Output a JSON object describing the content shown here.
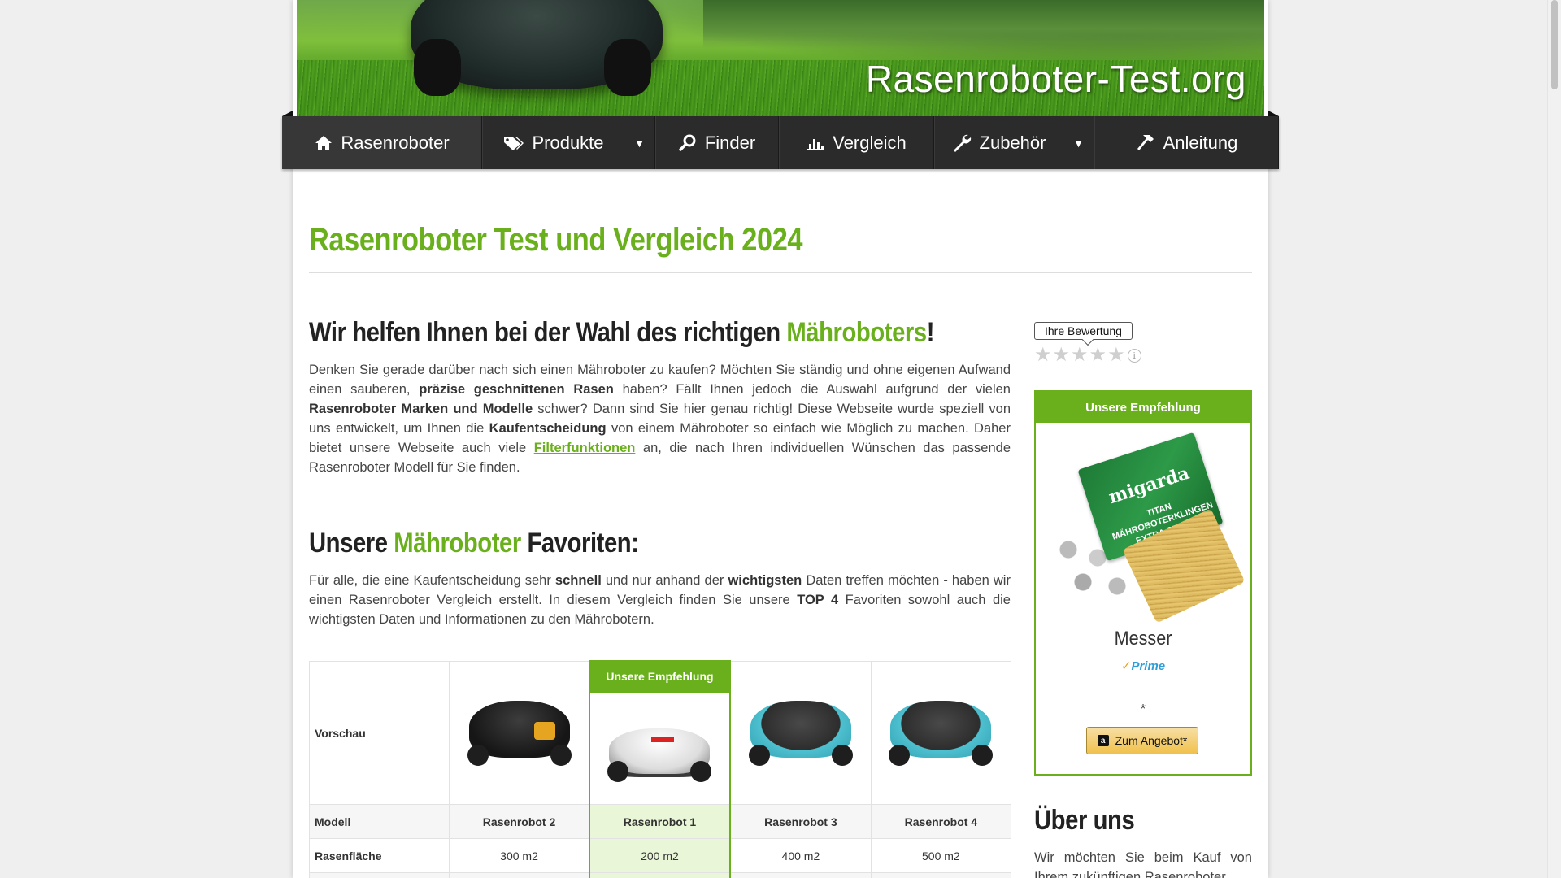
{
  "site": {
    "logo_text": "Rasenroboter-Test.org"
  },
  "nav": {
    "items": [
      {
        "label": "Rasenroboter",
        "icon": "home-icon",
        "has_dropdown": false,
        "active": true
      },
      {
        "label": "Produkte",
        "icon": "tags-icon",
        "has_dropdown": true,
        "active": false
      },
      {
        "label": "Finder",
        "icon": "search-icon",
        "has_dropdown": false,
        "active": false
      },
      {
        "label": "Vergleich",
        "icon": "bar-chart-icon",
        "has_dropdown": false,
        "active": false
      },
      {
        "label": "Zubehör",
        "icon": "wrench-icon",
        "has_dropdown": true,
        "active": false
      },
      {
        "label": "Anleitung",
        "icon": "hammer-icon",
        "has_dropdown": false,
        "active": false
      }
    ],
    "caret": "▼"
  },
  "page": {
    "title": "Rasenroboter Test und Vergleich 2024"
  },
  "intro": {
    "heading_pre": "Wir helfen Ihnen bei der Wahl des richtigen ",
    "heading_hl": "Mähroboters",
    "heading_post": "!",
    "p1": "Denken Sie gerade darüber nach sich einen Mähroboter zu kaufen? Möchten Sie ständig und ohne eigenen Aufwand einen sauberen, ",
    "b1": "präzise geschnittenen Rasen",
    "p2": " haben? Fällt Ihnen jedoch die Auswahl aufgrund der vielen ",
    "b2": "Rasenroboter Marken und Modelle",
    "p3": " schwer? Dann sind Sie hier genau richtig! Diese Webseite wurde speziell von uns entwickelt, um Ihnen die ",
    "b3": "Kaufentscheidung",
    "p4": " von einem Mähroboter so einfach wie Möglich zu machen. Daher bietet unsere Webseite auch viele ",
    "link": "Filterfunktionen",
    "p5": " an, die nach Ihren individuellen Wünschen das passende Rasenroboter Modell für Sie finden."
  },
  "favorites": {
    "heading_pre": "Unsere ",
    "heading_hl": "Mähroboter",
    "heading_post": " Favoriten:",
    "p1": "Für alle, die eine Kaufentscheidung sehr ",
    "b1": "schnell",
    "p2": " und nur anhand der ",
    "b2": "wichtigsten",
    "p3": " Daten treffen möchten - haben wir einen Rasenroboter Vergleich erstellt. In diesem Vergleich finden Sie unsere ",
    "b3": "TOP 4",
    "p4": " Favoriten sowohl auch die wichtigsten Daten und Informationen zu den Mährobotern."
  },
  "comparison": {
    "row_labels": {
      "preview": "Vorschau",
      "model": "Modell",
      "area": "Rasenfläche"
    },
    "recommend_badge": "Unsere Empfehlung",
    "products": [
      {
        "model": "Rasenrobot 2",
        "area": "300 m2",
        "style": "black",
        "recommended": false
      },
      {
        "model": "Rasenrobot 1",
        "area": "200 m2",
        "style": "white",
        "recommended": true
      },
      {
        "model": "Rasenrobot 3",
        "area": "400 m2",
        "style": "teal",
        "recommended": false
      },
      {
        "model": "Rasenrobot 4",
        "area": "500 m2",
        "style": "teal",
        "recommended": false
      }
    ]
  },
  "sidebar": {
    "rating_label": "Ihre Bewertung",
    "stars": 5,
    "info_glyph": "i",
    "recommendation": {
      "header": "Unsere Empfehlung",
      "pack_brand": "migarda",
      "pack_text": "TITAN MÄHROBOTERKLINGEN EXTRA STARK",
      "product_name": "Messer",
      "prime_check": "✓",
      "prime_label": "Prime",
      "asterisk": "*",
      "amazon_glyph": "a",
      "button_label": "Zum Angebot*"
    },
    "about": {
      "title": "Über uns",
      "text": "Wir möchten Sie beim Kauf von Ihrem zukünftigen Rasenroboter"
    }
  },
  "colors": {
    "accent": "#6ab01d",
    "nav_bg": "#2b2b2b",
    "button": "#f0c14b"
  }
}
